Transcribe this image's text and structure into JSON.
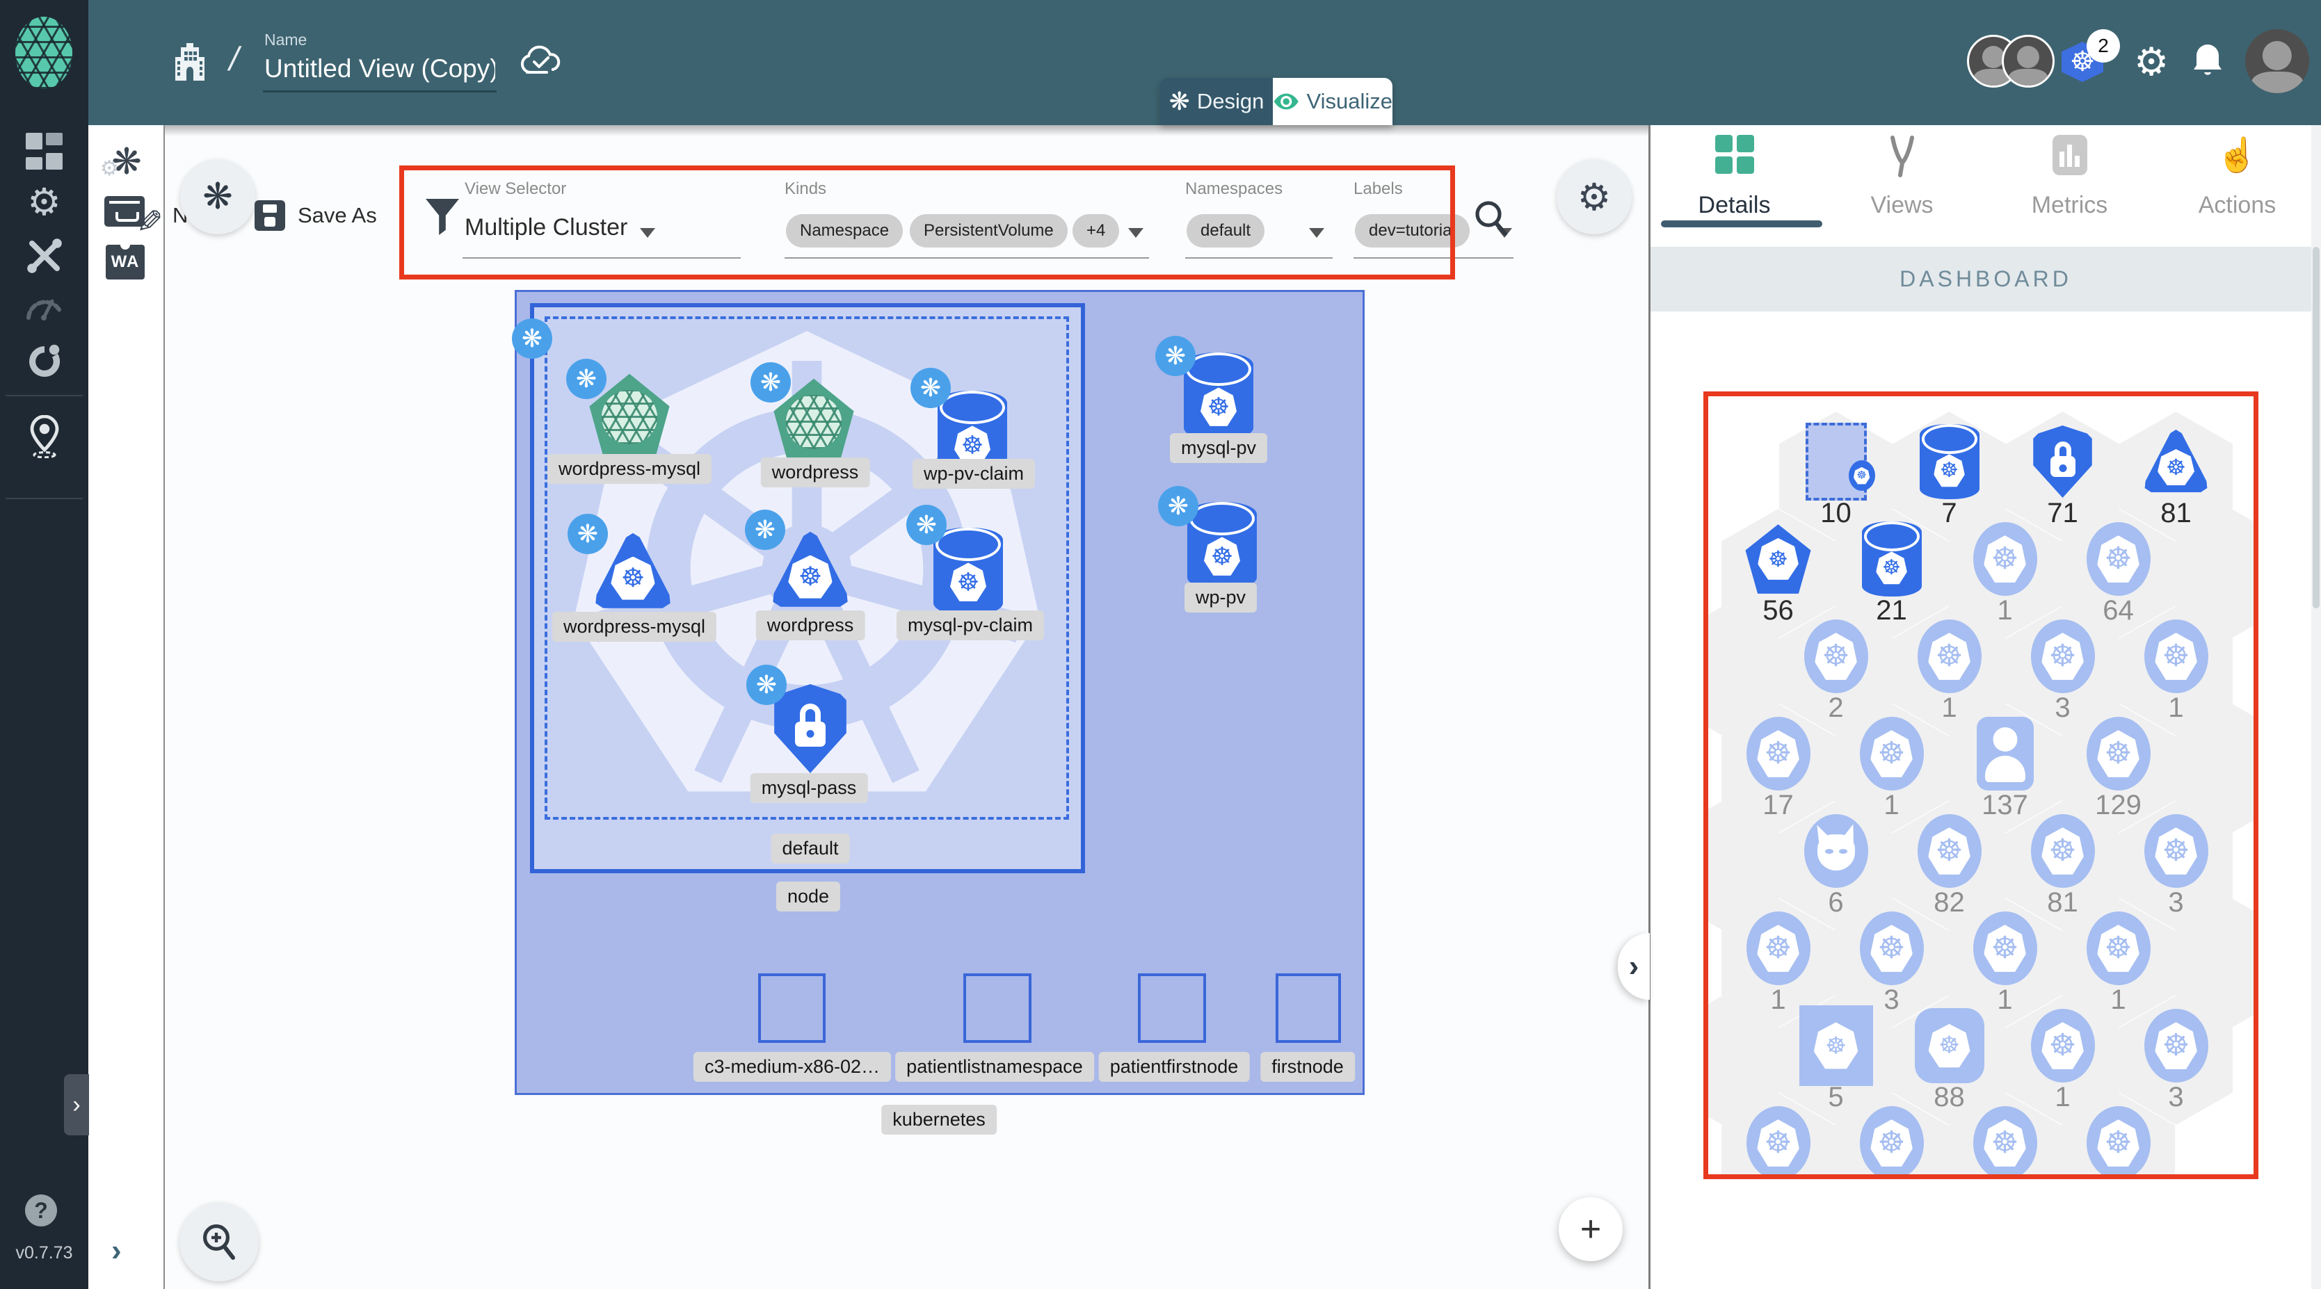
{
  "header": {
    "name_label": "Name",
    "view_title": "Untitled View (Copy)",
    "design_tab": "Design",
    "visualize_tab": "Visualize",
    "k8s_context_badge": "2"
  },
  "sidebar": {
    "icons": [
      "dashboard-icon",
      "lifecycle-gears-icon",
      "configuration-tools-icon",
      "performance-gauge-icon",
      "extensions-icon",
      "catalog-pin-icon"
    ],
    "help": "?",
    "version": "v0.7.73"
  },
  "gutter": {
    "icons": [
      "meshery-swirl-icon",
      "drawer-edit-icon",
      "wasm-icon"
    ]
  },
  "toolbar": {
    "new_label": "N",
    "save_as": "Save As",
    "filter": {
      "view_selector_label": "View Selector",
      "view_selector_value": "Multiple Cluster",
      "kinds_label": "Kinds",
      "kind_chips": [
        "Namespace",
        "PersistentVolume",
        "+4"
      ],
      "namespaces_label": "Namespaces",
      "namespace_chip": "default",
      "labels_label": "Labels",
      "label_chip": "dev=tutorial"
    }
  },
  "canvas": {
    "cluster_label": "kubernetes",
    "node_label": "node",
    "namespace_label": "default",
    "items": {
      "wp_mysql_svc": "wordpress-mysql",
      "wp_svc": "wordpress",
      "wp_pv_claim": "wp-pv-claim",
      "wp_mysql_dep": "wordpress-mysql",
      "wp_dep": "wordpress",
      "mysql_pv_claim": "mysql-pv-claim",
      "mysql_pass": "mysql-pass",
      "mysql_pv": "mysql-pv",
      "wp_pv": "wp-pv",
      "sq1": "c3-medium-x86-02…",
      "sq2": "patientlistnamespace",
      "sq3": "patientfirstnode",
      "sq4": "firstnode"
    }
  },
  "panel": {
    "tabs": [
      {
        "label": "Details",
        "icon": "grid-icon",
        "active": true
      },
      {
        "label": "Views",
        "icon": "views-y-icon",
        "active": false
      },
      {
        "label": "Metrics",
        "icon": "bar-chart-icon",
        "active": false
      },
      {
        "label": "Actions",
        "icon": "pointer-hand-icon",
        "active": false
      }
    ],
    "section_title": "DASHBOARD",
    "hexgrid": {
      "rows": [
        {
          "offset": "right",
          "cells": [
            {
              "type": "none"
            },
            {
              "type": "ns",
              "count": "10",
              "dim": false
            },
            {
              "type": "cyl",
              "count": "7",
              "dim": false
            },
            {
              "type": "shield",
              "count": "71",
              "dim": false
            },
            {
              "type": "tri",
              "count": "81",
              "dim": false
            }
          ]
        },
        {
          "offset": "left",
          "cells": [
            {
              "type": "pent",
              "count": "56",
              "dim": false
            },
            {
              "type": "cyl",
              "count": "21",
              "dim": false
            },
            {
              "type": "k8s",
              "count": "1",
              "dim": true
            },
            {
              "type": "k8s",
              "count": "64",
              "dim": true
            },
            {
              "type": "empty"
            }
          ]
        },
        {
          "offset": "right",
          "cells": [
            {
              "type": "empty"
            },
            {
              "type": "k8s",
              "count": "2",
              "dim": true
            },
            {
              "type": "k8s",
              "count": "1",
              "dim": true
            },
            {
              "type": "k8s",
              "count": "3",
              "dim": true
            },
            {
              "type": "k8s",
              "count": "1",
              "dim": true
            }
          ]
        },
        {
          "offset": "left",
          "cells": [
            {
              "type": "k8s",
              "count": "17",
              "dim": true
            },
            {
              "type": "k8s",
              "count": "1",
              "dim": true
            },
            {
              "type": "user",
              "count": "137",
              "dim": true
            },
            {
              "type": "k8s",
              "count": "129",
              "dim": true
            },
            {
              "type": "empty"
            }
          ]
        },
        {
          "offset": "right",
          "cells": [
            {
              "type": "empty"
            },
            {
              "type": "daemon",
              "count": "6",
              "dim": true
            },
            {
              "type": "k8s",
              "count": "82",
              "dim": true
            },
            {
              "type": "k8s",
              "count": "81",
              "dim": true
            },
            {
              "type": "k8s",
              "count": "3",
              "dim": true
            }
          ]
        },
        {
          "offset": "left",
          "cells": [
            {
              "type": "k8s",
              "count": "1",
              "dim": true
            },
            {
              "type": "k8s",
              "count": "3",
              "dim": true
            },
            {
              "type": "k8s",
              "count": "1",
              "dim": true
            },
            {
              "type": "k8s",
              "count": "1",
              "dim": true
            },
            {
              "type": "empty"
            }
          ]
        },
        {
          "offset": "right",
          "cells": [
            {
              "type": "empty"
            },
            {
              "type": "sq",
              "count": "5",
              "dim": true
            },
            {
              "type": "rsq",
              "count": "88",
              "dim": true
            },
            {
              "type": "k8s",
              "count": "1",
              "dim": true
            },
            {
              "type": "k8s",
              "count": "3",
              "dim": true
            }
          ]
        },
        {
          "offset": "left",
          "cells": [
            {
              "type": "k8s",
              "count": "",
              "dim": true
            },
            {
              "type": "k8s",
              "count": "",
              "dim": true
            },
            {
              "type": "k8s",
              "count": "",
              "dim": true
            },
            {
              "type": "k8s",
              "count": "",
              "dim": true
            },
            {
              "type": "none"
            }
          ]
        }
      ]
    }
  },
  "colors": {
    "header": "#3d6370",
    "sidebar": "#1f2933",
    "accent_green": "#4cbfa2",
    "k8s_blue": "#326de6",
    "light_blue": "#a6bef1",
    "cluster_fill": "#a9b8e9",
    "node_fill": "#c7d2f3",
    "annotation_red": "#e8391f"
  }
}
